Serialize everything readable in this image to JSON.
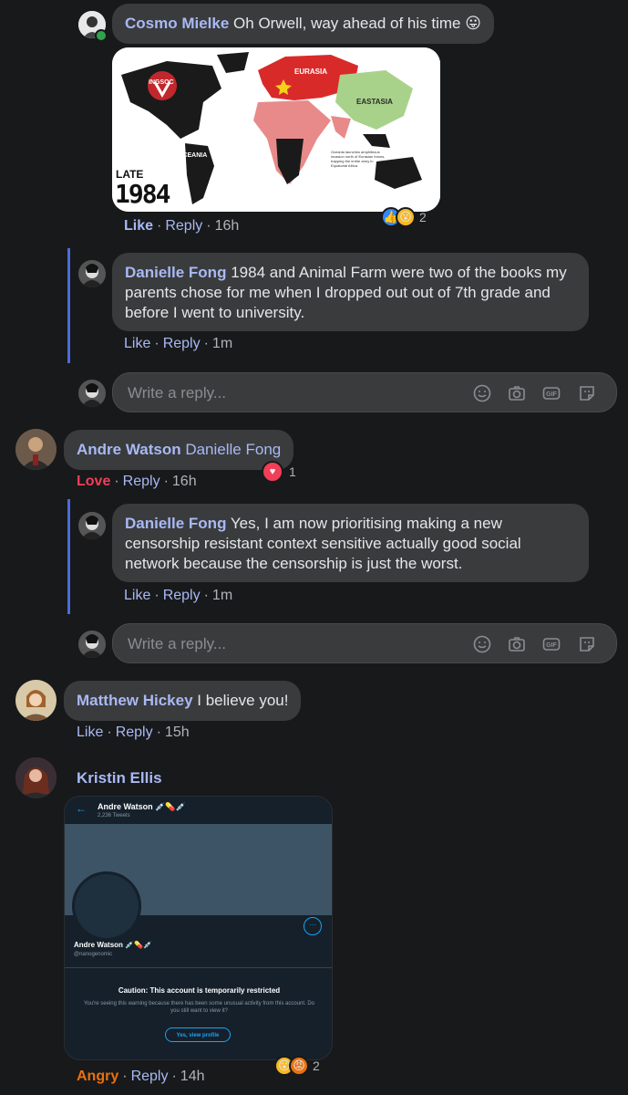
{
  "comments": [
    {
      "author": "Cosmo Mielke",
      "text": "Oh Orwell, way ahead of his time 😛",
      "action": "Like",
      "reply": "Reply",
      "time": "16h",
      "reaction_count": "2",
      "image": {
        "labels": [
          "INGSOC",
          "EURASIA",
          "EASTASIA",
          "OCEANIA",
          "LATE",
          "1984"
        ],
        "caption": "Oceania launches amphibious invasion north of Eurasian forces, trapping the entire army in Equatorial Africa"
      }
    },
    {
      "author": "Danielle Fong",
      "text": "1984 and Animal Farm were two of the books my parents chose for me when I dropped out out of 7th grade and before I went to university.",
      "action": "Like",
      "reply": "Reply",
      "time": "1m"
    },
    {
      "author": "Andre Watson",
      "text": "Danielle Fong",
      "action": "Love",
      "reply": "Reply",
      "time": "16h",
      "reaction_count": "1"
    },
    {
      "author": "Danielle Fong",
      "text": "Yes, I am now prioritising making a new censorship resistant context sensitive actually good social network because the censorship is just the worst.",
      "action": "Like",
      "reply": "Reply",
      "time": "1m"
    },
    {
      "author": "Matthew Hickey",
      "text": "I believe you!",
      "action": "Like",
      "reply": "Reply",
      "time": "15h"
    },
    {
      "author": "Kristin Ellis",
      "action": "Angry",
      "reply": "Reply",
      "time": "14h",
      "reaction_count": "2",
      "screenshot": {
        "profile_name": "Andre Watson 💉💊💉",
        "tweets": "2,236 Tweets",
        "handle": "@nanogenomic",
        "caution_title": "Caution: This account is temporarily restricted",
        "caution_body": "You're seeing this warning because there has been some unusual activity from this account. Do you still want to view it?",
        "view_button": "Yes, view profile"
      }
    }
  ],
  "reply_box": {
    "placeholder": "Write a reply..."
  },
  "icons": [
    "emoji-icon",
    "camera-icon",
    "gif-icon",
    "sticker-icon"
  ],
  "colors": {
    "background": "#18191a",
    "bubble": "#3a3b3c",
    "name": "#a8b9f5",
    "thread_line": "#4e6ad9",
    "love": "#f33e58",
    "angry": "#e9710f"
  }
}
